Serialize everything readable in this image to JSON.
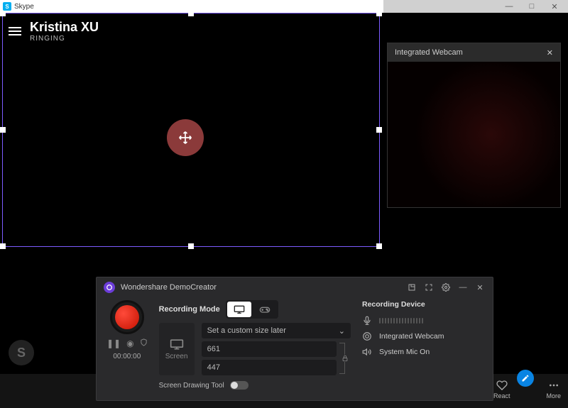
{
  "skype": {
    "app_name": "Skype",
    "caller_name": "Kristina XU",
    "call_status": "RINGING"
  },
  "right_window": {
    "minimize": "—",
    "maximize": "□",
    "close": "✕"
  },
  "webcam": {
    "title": "Integrated Webcam",
    "close": "✕"
  },
  "demo": {
    "app_title": "Wondershare DemoCreator",
    "recording_mode_label": "Recording Mode",
    "screen_label": "Screen",
    "size_preset": "Set a custom size later",
    "width": "661",
    "height": "447",
    "drawing_label": "Screen Drawing Tool",
    "device_title": "Recording Device",
    "camera_device": "Integrated Webcam",
    "mic_device": "System Mic On",
    "timer": "00:00:00"
  },
  "bottom": {
    "react": "React",
    "more": "More"
  }
}
